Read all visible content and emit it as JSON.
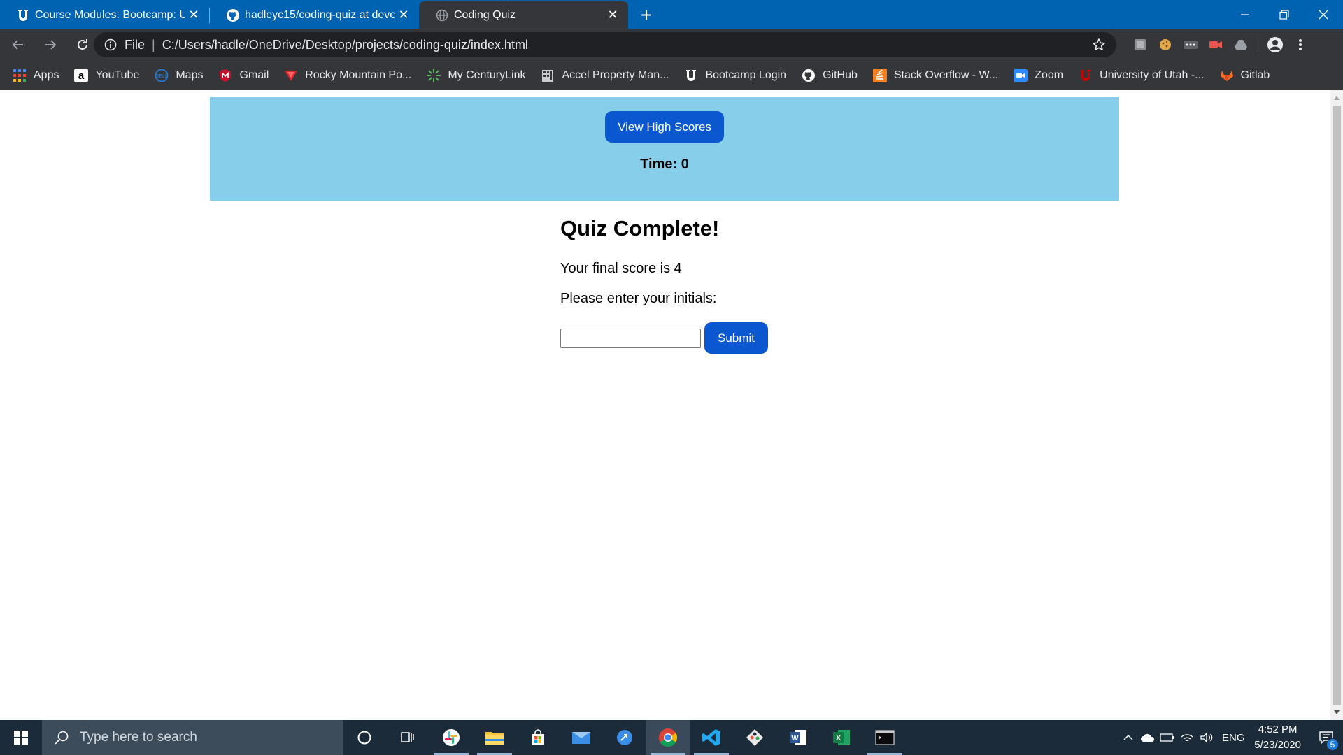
{
  "browser": {
    "tabs": [
      {
        "title": "Course Modules: Bootcamp: UofU",
        "favicon": "utah-u-icon",
        "active": false
      },
      {
        "title": "hadleyc15/coding-quiz at develop",
        "favicon": "github-icon",
        "active": false
      },
      {
        "title": "Coding Quiz",
        "favicon": "globe-icon",
        "active": true
      }
    ],
    "new_tab_label": "+",
    "omnibox": {
      "scheme_label": "File",
      "url": "C:/Users/hadle/OneDrive/Desktop/projects/coding-quiz/index.html"
    },
    "bookmarks": [
      {
        "label": "Apps",
        "icon": "apps-grid-icon"
      },
      {
        "label": "YouTube",
        "icon": "amazon-icon"
      },
      {
        "label": "Maps",
        "icon": "dell-icon"
      },
      {
        "label": "Gmail",
        "icon": "mcafee-icon"
      },
      {
        "label": "Rocky Mountain Po...",
        "icon": "rocky-mountain-icon"
      },
      {
        "label": "My CenturyLink",
        "icon": "centurylink-icon"
      },
      {
        "label": "Accel Property Man...",
        "icon": "building-icon"
      },
      {
        "label": "Bootcamp Login",
        "icon": "utah-u-icon"
      },
      {
        "label": "GitHub",
        "icon": "github-icon"
      },
      {
        "label": "Stack Overflow - W...",
        "icon": "stackoverflow-icon"
      },
      {
        "label": "Zoom",
        "icon": "zoom-icon"
      },
      {
        "label": "University of Utah -...",
        "icon": "utah-u-icon"
      },
      {
        "label": "Gitlab",
        "icon": "gitlab-icon"
      }
    ]
  },
  "page": {
    "header": {
      "high_scores_label": "View High Scores",
      "timer_text": "Time: 0"
    },
    "quiz": {
      "title": "Quiz Complete!",
      "score_text": "Your final score is 4",
      "prompt_text": "Please enter your initials:",
      "initials_value": "",
      "submit_label": "Submit"
    }
  },
  "taskbar": {
    "search_placeholder": "Type here to search",
    "language": "ENG",
    "time": "4:52 PM",
    "date": "5/23/2020",
    "notification_count": "5"
  },
  "colors": {
    "titlebar": "#0063b1",
    "toolbar": "#35363a",
    "header_bg": "#87ceeb",
    "button_blue": "#0b57d0",
    "taskbar": "#1c2b3a"
  }
}
